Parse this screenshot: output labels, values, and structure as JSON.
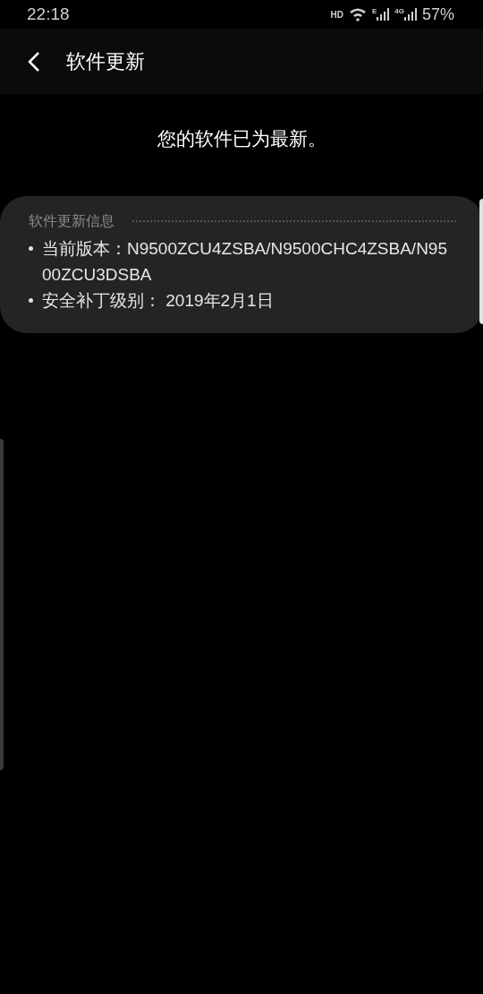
{
  "status_bar": {
    "time": "22:18",
    "hd": "HD",
    "network_e": "E",
    "network_4g": "4G",
    "battery": "57%"
  },
  "header": {
    "title": "软件更新"
  },
  "message": "您的软件已为最新。",
  "info_card": {
    "title": "软件更新信息",
    "items": [
      {
        "text": "当前版本：N9500ZCU4ZSBA/N9500CHC4ZSBA/N9500ZCU3DSBA"
      },
      {
        "text": "安全补丁级别： 2019年2月1日"
      }
    ]
  }
}
